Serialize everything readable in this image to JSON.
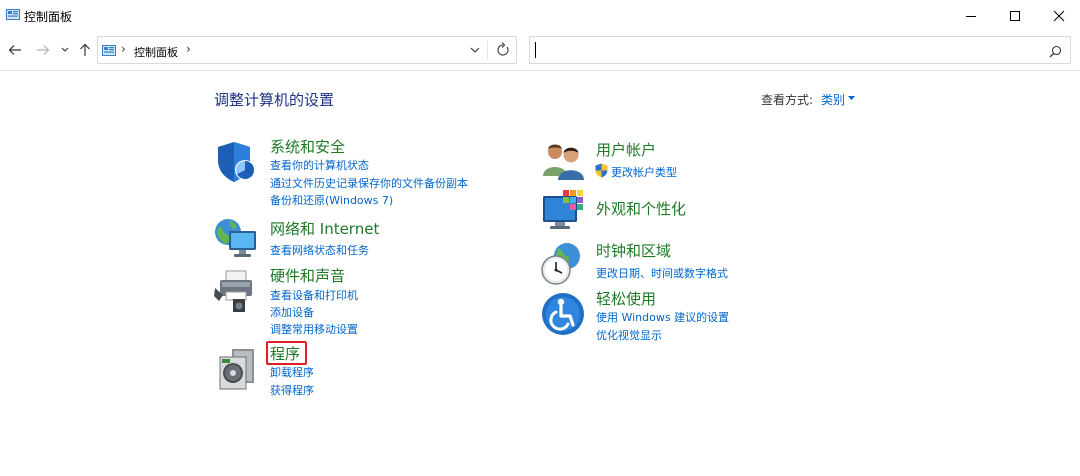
{
  "window": {
    "title": "控制面板"
  },
  "nav": {
    "breadcrumb": "控制面板",
    "search_value": ""
  },
  "main": {
    "heading": "调整计算机的设置",
    "view_by_label": "查看方式:",
    "view_by_value": "类别"
  },
  "categories": [
    {
      "title": "系统和安全",
      "links": [
        "查看你的计算机状态",
        "通过文件历史记录保存你的文件备份副本",
        "备份和还原(Windows 7)"
      ]
    },
    {
      "title": "网络和 Internet",
      "links": [
        "查看网络状态和任务"
      ]
    },
    {
      "title": "硬件和声音",
      "links": [
        "查看设备和打印机",
        "添加设备",
        "调整常用移动设置"
      ]
    },
    {
      "title": "程序",
      "links": [
        "卸载程序",
        "获得程序"
      ]
    },
    {
      "title": "用户帐户",
      "links": [
        "更改帐户类型"
      ]
    },
    {
      "title": "外观和个性化",
      "links": []
    },
    {
      "title": "时钟和区域",
      "links": [
        "更改日期、时间或数字格式"
      ]
    },
    {
      "title": "轻松使用",
      "links": [
        "使用 Windows 建议的设置",
        "优化视觉显示"
      ]
    }
  ],
  "colors": {
    "heading": "#1e3287",
    "category_title": "#1e7a28",
    "link": "#0066cc",
    "highlight": "#e02020"
  }
}
